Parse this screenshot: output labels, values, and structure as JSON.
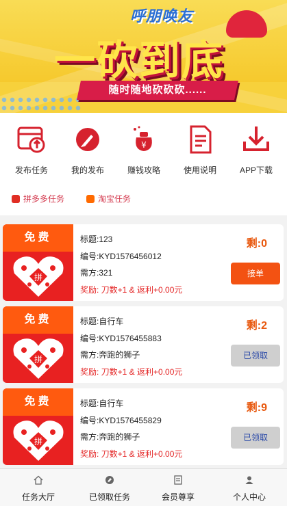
{
  "banner": {
    "brand": "呼朋唤友",
    "headline": "一砍到底",
    "subline": "随时随地砍砍砍......"
  },
  "menu": {
    "items": [
      {
        "label": "发布任务",
        "icon": "publish-task-icon"
      },
      {
        "label": "我的发布",
        "icon": "my-publish-icon"
      },
      {
        "label": "赚钱攻略",
        "icon": "money-bag-icon"
      },
      {
        "label": "使用说明",
        "icon": "document-icon"
      },
      {
        "label": "APP下载",
        "icon": "download-icon"
      }
    ],
    "tags": [
      {
        "label": "拼多多任务",
        "icon": "pinduoduo-icon"
      },
      {
        "label": "淘宝任务",
        "icon": "taobao-icon"
      }
    ]
  },
  "tasks": [
    {
      "badge": "免费",
      "title": "标题:123",
      "code": "编号:KYD1576456012",
      "requester": "需方:321",
      "reward": "奖励: 刀数+1 & 返利+0.00元",
      "remain": "剩:0",
      "button": "接单"
    },
    {
      "badge": "免费",
      "title": "标题:自行车",
      "code": "编号:KYD1576455883",
      "requester": "需方:奔跑的狮子",
      "reward": "奖励: 刀数+1 & 返利+0.00元",
      "remain": "剩:2",
      "button": "已领取"
    },
    {
      "badge": "免费",
      "title": "标题:自行车",
      "code": "编号:KYD1576455829",
      "requester": "需方:奔跑的狮子",
      "reward": "奖励: 刀数+1 & 返利+0.00元",
      "remain": "剩:9",
      "button": "已领取"
    }
  ],
  "tabbar": {
    "tabs": [
      {
        "label": "任务大厅",
        "icon": "home-icon"
      },
      {
        "label": "已领取任务",
        "icon": "received-tasks-icon"
      },
      {
        "label": "会员尊享",
        "icon": "member-icon"
      },
      {
        "label": "个人中心",
        "icon": "user-icon"
      }
    ]
  },
  "colors": {
    "accent": "#f35212",
    "brand_red": "#d81d48",
    "remain": "#e8580e",
    "reward": "#e42525",
    "taken_button": "#cfcfcf"
  }
}
